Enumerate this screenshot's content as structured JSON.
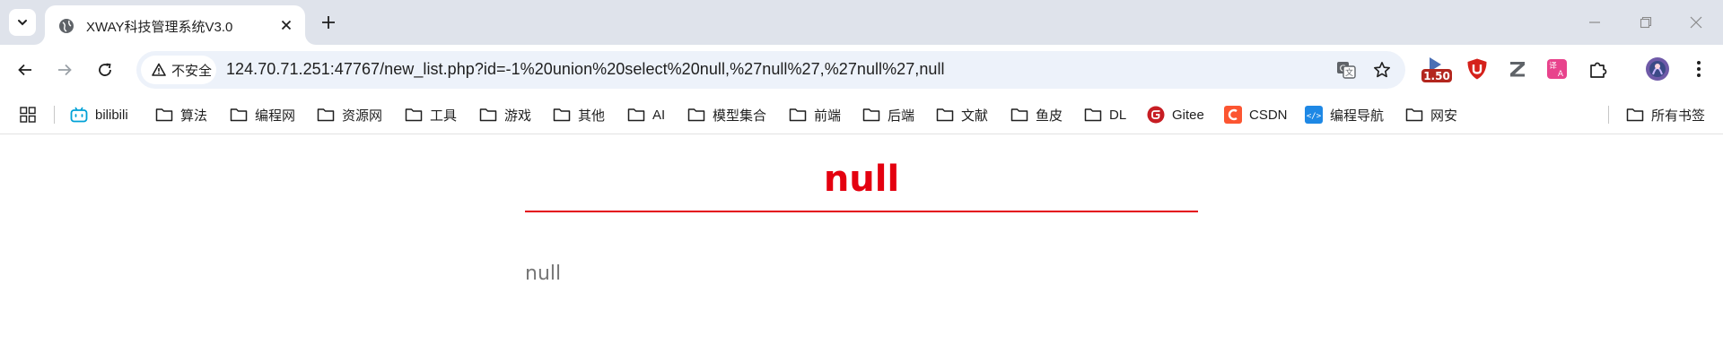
{
  "tab": {
    "title": "XWAY科技管理系统V3.0"
  },
  "omnibox": {
    "security_label": "不安全",
    "url": "124.70.71.251:47767/new_list.php?id=-1%20union%20select%20null,%27null%27,%27null%27,null"
  },
  "extensions": {
    "speed_badge": "1.50"
  },
  "bookmarks": [
    {
      "label": "bilibili",
      "icon": "bilibili-icon"
    },
    {
      "label": "算法",
      "icon": "folder-icon"
    },
    {
      "label": "编程网",
      "icon": "folder-icon"
    },
    {
      "label": "资源网",
      "icon": "folder-icon"
    },
    {
      "label": "工具",
      "icon": "folder-icon"
    },
    {
      "label": "游戏",
      "icon": "folder-icon"
    },
    {
      "label": "其他",
      "icon": "folder-icon"
    },
    {
      "label": "AI",
      "icon": "folder-icon"
    },
    {
      "label": "模型集合",
      "icon": "folder-icon"
    },
    {
      "label": "前端",
      "icon": "folder-icon"
    },
    {
      "label": "后端",
      "icon": "folder-icon"
    },
    {
      "label": "文献",
      "icon": "folder-icon"
    },
    {
      "label": "鱼皮",
      "icon": "folder-icon"
    },
    {
      "label": "DL",
      "icon": "folder-icon"
    },
    {
      "label": "Gitee",
      "icon": "gitee-icon"
    },
    {
      "label": "CSDN",
      "icon": "csdn-icon"
    },
    {
      "label": "编程导航",
      "icon": "code-nav-icon"
    },
    {
      "label": "网安",
      "icon": "folder-icon"
    }
  ],
  "all_bookmarks_label": "所有书签",
  "page": {
    "title": "null",
    "body": "null"
  },
  "colors": {
    "title_red": "#e4000f",
    "body_gray": "#777777",
    "tabstrip": "#dfe3eb",
    "omnibox": "#edf2fa"
  }
}
